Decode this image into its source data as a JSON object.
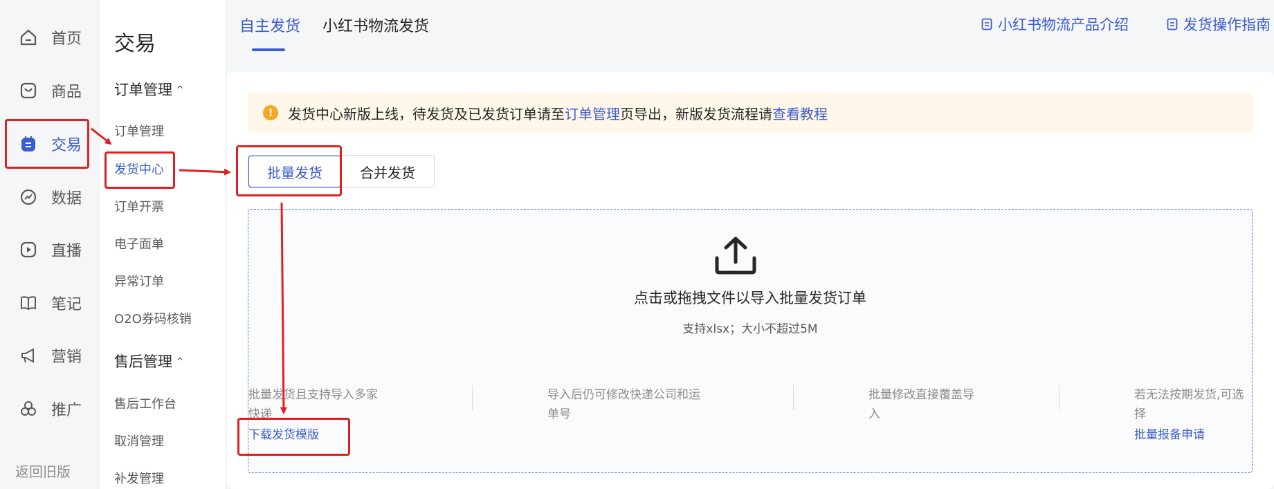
{
  "left_nav": {
    "items": [
      {
        "label": "首页",
        "icon": "home-icon"
      },
      {
        "label": "商品",
        "icon": "bag-icon"
      },
      {
        "label": "交易",
        "icon": "trade-icon"
      },
      {
        "label": "数据",
        "icon": "chart-icon"
      },
      {
        "label": "直播",
        "icon": "play-icon"
      },
      {
        "label": "笔记",
        "icon": "book-icon"
      },
      {
        "label": "营销",
        "icon": "megaphone-icon"
      },
      {
        "label": "推广",
        "icon": "promote-icon"
      }
    ],
    "active": "交易",
    "back_label": "返回旧版"
  },
  "sub_nav": {
    "title": "交易",
    "groups": [
      {
        "label": "订单管理",
        "items": [
          "订单管理",
          "发货中心",
          "订单开票",
          "电子面单",
          "异常订单",
          "O2O券码核销"
        ]
      },
      {
        "label": "售后管理",
        "items": [
          "售后工作台",
          "取消管理",
          "补发管理"
        ]
      }
    ],
    "active": "发货中心"
  },
  "top_tabs": {
    "tabs": [
      "自主发货",
      "小红书物流发货"
    ],
    "active": "自主发货",
    "links": [
      "小红书物流产品介绍",
      "发货操作指南"
    ]
  },
  "notice": {
    "text_before": "发货中心新版上线，待发货及已发货订单请至",
    "link1": "订单管理",
    "text_middle": "页导出，新版发货流程请",
    "link2": "查看教程"
  },
  "segments": {
    "options": [
      "批量发货",
      "合并发货"
    ],
    "active": "批量发货"
  },
  "dropzone": {
    "title": "点击或拖拽文件以导入批量发货订单",
    "subtitle": "支持xlsx；大小不超过5M"
  },
  "features": [
    {
      "line1": "批量发货且支持导入多家",
      "line2": "快递",
      "link": "下载发货模版"
    },
    {
      "line1": "导入后仍可修改快递公司和运",
      "line2": "单号",
      "link": ""
    },
    {
      "line1": "批量修改直接覆盖导",
      "line2": "入",
      "link": ""
    },
    {
      "line1": "若无法按期发货,可选",
      "line2": "择",
      "link": "批量报备申请"
    }
  ],
  "colors": {
    "accent": "#3a5ccc",
    "annotation_red": "#e02020",
    "notice_bg": "#fff8ea",
    "warning": "#f5a623"
  }
}
